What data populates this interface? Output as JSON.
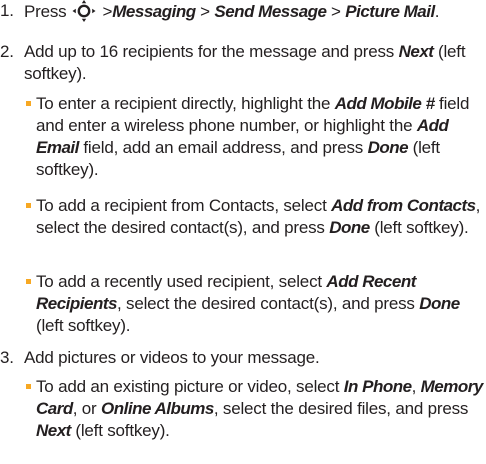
{
  "steps": [
    {
      "number": "1.",
      "parts": [
        {
          "t": "Press "
        },
        {
          "icon": "navigation-key-icon"
        },
        {
          "t": " >"
        },
        {
          "em": "Messaging"
        },
        {
          "t": " > "
        },
        {
          "em": "Send Message"
        },
        {
          "t": " > "
        },
        {
          "em": "Picture Mail"
        },
        {
          "t": "."
        }
      ]
    },
    {
      "number": "2.",
      "parts": [
        {
          "t": "Add up to 16 recipients for the message and press "
        },
        {
          "em": "Next"
        },
        {
          "t": " (left softkey)."
        }
      ],
      "subitems": [
        [
          {
            "t": "To enter a recipient directly, highlight the "
          },
          {
            "em": "Add Mobile #"
          },
          {
            "t": " field and enter a wireless phone number, or highlight the "
          },
          {
            "em": "Add Email"
          },
          {
            "t": " field, add an email address, and press "
          },
          {
            "em": "Done"
          },
          {
            "t": " (left softkey)."
          }
        ],
        [
          {
            "t": "To add a recipient from Contacts, select "
          },
          {
            "em": "Add from Contacts"
          },
          {
            "t": ", select the desired contact(s), and press "
          },
          {
            "em": "Done"
          },
          {
            "t": " (left softkey)."
          }
        ],
        [
          {
            "t": "To add a recently used recipient, select "
          },
          {
            "em": "Add Recent Recipients"
          },
          {
            "t": ", select the desired contact(s), and press "
          },
          {
            "em": "Done"
          },
          {
            "t": " (left softkey)."
          }
        ]
      ]
    },
    {
      "number": "3.",
      "parts": [
        {
          "t": "Add pictures or videos to your message."
        }
      ],
      "subitems": [
        [
          {
            "t": "To add an existing picture or video, select "
          },
          {
            "em": "In Phone"
          },
          {
            "t": ", "
          },
          {
            "em": "Memory Card"
          },
          {
            "t": ", or "
          },
          {
            "em": "Online Albums"
          },
          {
            "t": ", select the desired files, and press "
          },
          {
            "em": "Next"
          },
          {
            "t": " (left softkey)."
          }
        ]
      ]
    }
  ],
  "colors": {
    "text": "#231f20",
    "bullet": "#f7a823"
  }
}
